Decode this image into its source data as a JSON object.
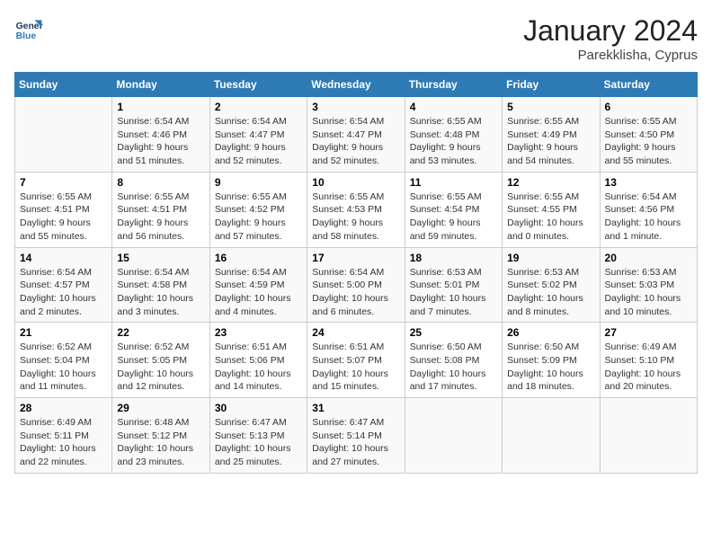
{
  "header": {
    "logo_line1": "General",
    "logo_line2": "Blue",
    "month": "January 2024",
    "location": "Parekklisha, Cyprus"
  },
  "days_of_week": [
    "Sunday",
    "Monday",
    "Tuesday",
    "Wednesday",
    "Thursday",
    "Friday",
    "Saturday"
  ],
  "weeks": [
    [
      {
        "day": "",
        "info": ""
      },
      {
        "day": "1",
        "info": "Sunrise: 6:54 AM\nSunset: 4:46 PM\nDaylight: 9 hours\nand 51 minutes."
      },
      {
        "day": "2",
        "info": "Sunrise: 6:54 AM\nSunset: 4:47 PM\nDaylight: 9 hours\nand 52 minutes."
      },
      {
        "day": "3",
        "info": "Sunrise: 6:54 AM\nSunset: 4:47 PM\nDaylight: 9 hours\nand 52 minutes."
      },
      {
        "day": "4",
        "info": "Sunrise: 6:55 AM\nSunset: 4:48 PM\nDaylight: 9 hours\nand 53 minutes."
      },
      {
        "day": "5",
        "info": "Sunrise: 6:55 AM\nSunset: 4:49 PM\nDaylight: 9 hours\nand 54 minutes."
      },
      {
        "day": "6",
        "info": "Sunrise: 6:55 AM\nSunset: 4:50 PM\nDaylight: 9 hours\nand 55 minutes."
      }
    ],
    [
      {
        "day": "7",
        "info": "Sunrise: 6:55 AM\nSunset: 4:51 PM\nDaylight: 9 hours\nand 55 minutes."
      },
      {
        "day": "8",
        "info": "Sunrise: 6:55 AM\nSunset: 4:51 PM\nDaylight: 9 hours\nand 56 minutes."
      },
      {
        "day": "9",
        "info": "Sunrise: 6:55 AM\nSunset: 4:52 PM\nDaylight: 9 hours\nand 57 minutes."
      },
      {
        "day": "10",
        "info": "Sunrise: 6:55 AM\nSunset: 4:53 PM\nDaylight: 9 hours\nand 58 minutes."
      },
      {
        "day": "11",
        "info": "Sunrise: 6:55 AM\nSunset: 4:54 PM\nDaylight: 9 hours\nand 59 minutes."
      },
      {
        "day": "12",
        "info": "Sunrise: 6:55 AM\nSunset: 4:55 PM\nDaylight: 10 hours\nand 0 minutes."
      },
      {
        "day": "13",
        "info": "Sunrise: 6:54 AM\nSunset: 4:56 PM\nDaylight: 10 hours\nand 1 minute."
      }
    ],
    [
      {
        "day": "14",
        "info": "Sunrise: 6:54 AM\nSunset: 4:57 PM\nDaylight: 10 hours\nand 2 minutes."
      },
      {
        "day": "15",
        "info": "Sunrise: 6:54 AM\nSunset: 4:58 PM\nDaylight: 10 hours\nand 3 minutes."
      },
      {
        "day": "16",
        "info": "Sunrise: 6:54 AM\nSunset: 4:59 PM\nDaylight: 10 hours\nand 4 minutes."
      },
      {
        "day": "17",
        "info": "Sunrise: 6:54 AM\nSunset: 5:00 PM\nDaylight: 10 hours\nand 6 minutes."
      },
      {
        "day": "18",
        "info": "Sunrise: 6:53 AM\nSunset: 5:01 PM\nDaylight: 10 hours\nand 7 minutes."
      },
      {
        "day": "19",
        "info": "Sunrise: 6:53 AM\nSunset: 5:02 PM\nDaylight: 10 hours\nand 8 minutes."
      },
      {
        "day": "20",
        "info": "Sunrise: 6:53 AM\nSunset: 5:03 PM\nDaylight: 10 hours\nand 10 minutes."
      }
    ],
    [
      {
        "day": "21",
        "info": "Sunrise: 6:52 AM\nSunset: 5:04 PM\nDaylight: 10 hours\nand 11 minutes."
      },
      {
        "day": "22",
        "info": "Sunrise: 6:52 AM\nSunset: 5:05 PM\nDaylight: 10 hours\nand 12 minutes."
      },
      {
        "day": "23",
        "info": "Sunrise: 6:51 AM\nSunset: 5:06 PM\nDaylight: 10 hours\nand 14 minutes."
      },
      {
        "day": "24",
        "info": "Sunrise: 6:51 AM\nSunset: 5:07 PM\nDaylight: 10 hours\nand 15 minutes."
      },
      {
        "day": "25",
        "info": "Sunrise: 6:50 AM\nSunset: 5:08 PM\nDaylight: 10 hours\nand 17 minutes."
      },
      {
        "day": "26",
        "info": "Sunrise: 6:50 AM\nSunset: 5:09 PM\nDaylight: 10 hours\nand 18 minutes."
      },
      {
        "day": "27",
        "info": "Sunrise: 6:49 AM\nSunset: 5:10 PM\nDaylight: 10 hours\nand 20 minutes."
      }
    ],
    [
      {
        "day": "28",
        "info": "Sunrise: 6:49 AM\nSunset: 5:11 PM\nDaylight: 10 hours\nand 22 minutes."
      },
      {
        "day": "29",
        "info": "Sunrise: 6:48 AM\nSunset: 5:12 PM\nDaylight: 10 hours\nand 23 minutes."
      },
      {
        "day": "30",
        "info": "Sunrise: 6:47 AM\nSunset: 5:13 PM\nDaylight: 10 hours\nand 25 minutes."
      },
      {
        "day": "31",
        "info": "Sunrise: 6:47 AM\nSunset: 5:14 PM\nDaylight: 10 hours\nand 27 minutes."
      },
      {
        "day": "",
        "info": ""
      },
      {
        "day": "",
        "info": ""
      },
      {
        "day": "",
        "info": ""
      }
    ]
  ]
}
